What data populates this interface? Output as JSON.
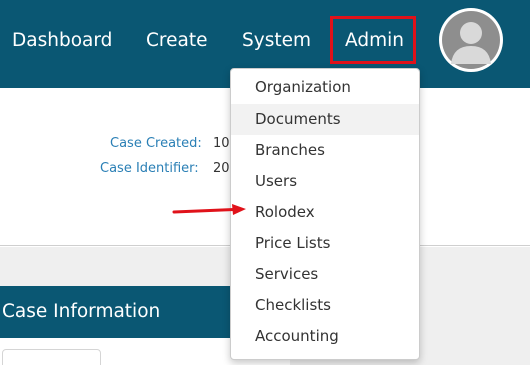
{
  "nav": {
    "dashboard": "Dashboard",
    "create": "Create",
    "system": "System",
    "admin": "Admin",
    "avatar_icon": "user-avatar-icon"
  },
  "case_info": {
    "created_label": "Case Created:",
    "created_value": "10,",
    "identifier_label": "Case Identifier:",
    "identifier_value": "20"
  },
  "panel": {
    "title": "Case Information"
  },
  "admin_menu": {
    "items": [
      "Organization",
      "Documents",
      "Branches",
      "Users",
      "Rolodex",
      "Price Lists",
      "Services",
      "Checklists",
      "Accounting"
    ],
    "highlighted": "Documents",
    "arrow_points_to": "Rolodex"
  },
  "colors": {
    "topbar": "#0a5773",
    "highlight_box": "#e0121a",
    "label_blue": "#2a7fb5",
    "arrow": "#e0121a"
  }
}
